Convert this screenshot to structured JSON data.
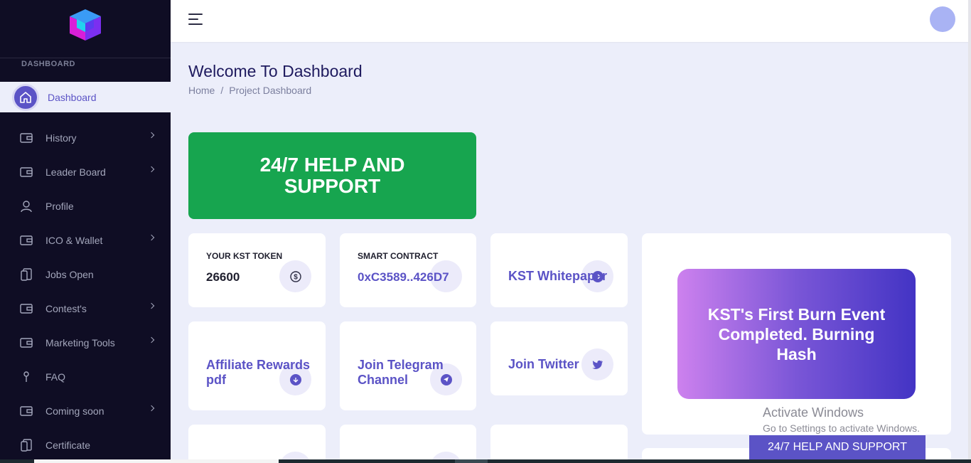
{
  "sidebar": {
    "section_label": "DASHBOARD",
    "active_label": "Dashboard",
    "items": [
      {
        "label": "History",
        "icon": "wallet-icon",
        "chevron": true
      },
      {
        "label": "Leader Board",
        "icon": "wallet-icon",
        "chevron": true
      },
      {
        "label": "Profile",
        "icon": "user-icon",
        "chevron": false
      },
      {
        "label": "ICO & Wallet",
        "icon": "wallet-icon",
        "chevron": true
      },
      {
        "label": "Jobs Open",
        "icon": "document-icon",
        "chevron": false
      },
      {
        "label": "Contest's",
        "icon": "wallet-icon",
        "chevron": true
      },
      {
        "label": "Marketing Tools",
        "icon": "wallet-icon",
        "chevron": true
      },
      {
        "label": "FAQ",
        "icon": "pin-icon",
        "chevron": false
      },
      {
        "label": "Coming soon",
        "icon": "wallet-icon",
        "chevron": true
      },
      {
        "label": "Certificate",
        "icon": "document-icon",
        "chevron": false
      }
    ]
  },
  "main": {
    "title": "Welcome To Dashboard",
    "breadcrumb": {
      "home": "Home",
      "sep": "/",
      "current": "Project Dashboard"
    },
    "help_card": "24/7 HELP AND SUPPORT",
    "token": {
      "label": "YOUR KST TOKEN",
      "value": "26600"
    },
    "contract": {
      "label": "SMART CONTRACT",
      "value": "0xC3589..426D7"
    },
    "whitepaper": "KST Whitepaper",
    "affiliate": "Affiliate Rewards pdf",
    "telegram": "Join Telegram Channel",
    "twitter": "Join Twitter",
    "promo": "KST's First Burn Event Completed. Burning Hash"
  },
  "overlay": {
    "activate_title": "Activate Windows",
    "activate_sub": "Go to Settings to activate Windows.",
    "help_bar": "24/7 HELP AND SUPPORT"
  },
  "colors": {
    "accent": "#5b53c6",
    "sidebar": "#0f0d24",
    "green": "#17a54f"
  }
}
